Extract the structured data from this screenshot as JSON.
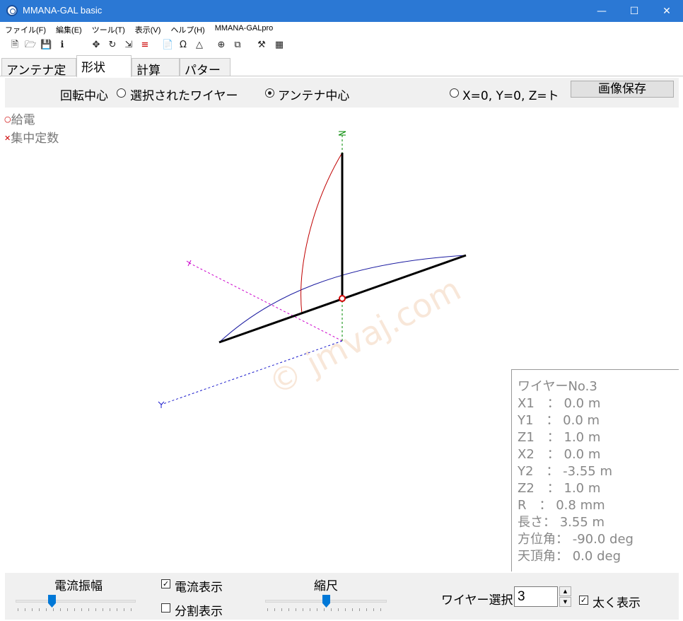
{
  "window": {
    "title": "MMANA-GAL basic"
  },
  "menu": [
    "ファイル(F)",
    "編集(E)",
    "ツール(T)",
    "表示(V)",
    "ヘルプ(H)",
    "MMANA-GALpro"
  ],
  "tabs": [
    "アンテナ定義",
    "形状",
    "計算",
    "パターン"
  ],
  "controls": {
    "rotation_label": "回転中心",
    "radio_selected_wire": "選択されたワイヤー",
    "radio_antenna_center": "アンテナ中心",
    "radio_xyz": "X=0, Y=0, Z=ト",
    "save_image": "画像保存"
  },
  "legend": {
    "feed": "給電",
    "load": "集中定数"
  },
  "watermark": "© jmvaj.com",
  "info": {
    "title": "ワイヤーNo.3",
    "lines": [
      "X1　：  0.0 m",
      "Y1　：  0.0 m",
      "Z1　：  1.0 m",
      "X2　：  0.0 m",
      "Y2　：  -3.55 m",
      "Z2　：  1.0 m",
      "R　：  0.8 mm",
      "長さ：  3.55 m",
      "方位角：  -90.0 deg",
      "天頂角：  0.0 deg"
    ]
  },
  "bottom": {
    "current_amp_label": "電流振幅",
    "current_amp_level": 0.3,
    "show_current": "電流表示",
    "show_current_checked": true,
    "show_split": "分割表示",
    "show_split_checked": false,
    "scale_label": "縮尺",
    "scale_level": 0.5,
    "wire_select_label": "ワイヤー選択",
    "wire_select_value": "3",
    "bold_display": "太く表示",
    "bold_display_checked": true
  },
  "colors": {
    "titlebar": "#2b78d4",
    "wire": "#000000",
    "current_blue": "#1a1aa0",
    "current_red": "#c00000",
    "axis_x": "#cc00cc",
    "axis_y": "#1a1acc",
    "axis_z": "#008800",
    "accent": "#0078d7"
  }
}
